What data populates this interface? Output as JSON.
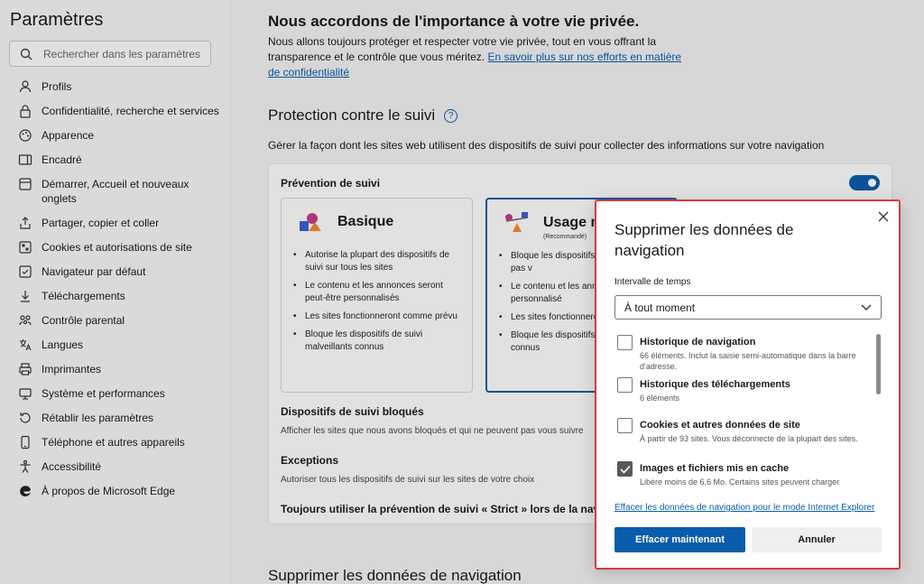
{
  "sidebar": {
    "title": "Paramètres",
    "search_placeholder": "Rechercher dans les paramètres",
    "items": [
      {
        "label": "Profils",
        "icon": "profile-icon"
      },
      {
        "label": "Confidentialité, recherche et services",
        "icon": "lock-icon"
      },
      {
        "label": "Apparence",
        "icon": "appearance-icon"
      },
      {
        "label": "Encadré",
        "icon": "sidebar-icon"
      },
      {
        "label": "Démarrer, Accueil et nouveaux onglets",
        "icon": "home-icon"
      },
      {
        "label": "Partager, copier et coller",
        "icon": "share-icon"
      },
      {
        "label": "Cookies et autorisations de site",
        "icon": "cookie-icon"
      },
      {
        "label": "Navigateur par défaut",
        "icon": "browser-icon"
      },
      {
        "label": "Téléchargements",
        "icon": "download-icon"
      },
      {
        "label": "Contrôle parental",
        "icon": "family-icon"
      },
      {
        "label": "Langues",
        "icon": "language-icon"
      },
      {
        "label": "Imprimantes",
        "icon": "printer-icon"
      },
      {
        "label": "Système et performances",
        "icon": "system-icon"
      },
      {
        "label": "Rétablir les paramètres",
        "icon": "reset-icon"
      },
      {
        "label": "Téléphone et autres appareils",
        "icon": "phone-icon"
      },
      {
        "label": "Accessibilité",
        "icon": "accessibility-icon"
      },
      {
        "label": "À propos de Microsoft Edge",
        "icon": "edge-icon"
      }
    ]
  },
  "main": {
    "privacy_title": "Nous accordons de l'importance à votre vie privée.",
    "privacy_desc": "Nous allons toujours protéger et respecter votre vie privée, tout en vous offrant la transparence et le contrôle que vous méritez.",
    "privacy_link": "En savoir plus sur nos efforts en matière de confidentialité",
    "tracking_title": "Protection contre le suivi",
    "tracking_desc": "Gérer la façon dont les sites web utilisent des dispositifs de suivi pour collecter des informations sur votre navigation",
    "prevention_label": "Prévention de suivi",
    "prevention_enabled": true,
    "options": {
      "basic": {
        "name": "Basique",
        "bullets": [
          "Autorise la plupart des dispositifs de suivi sur tous les sites",
          "Le contenu et les annonces seront peut-être personnalisés",
          "Les sites fonctionneront comme prévu",
          "Bloque les dispositifs de suivi malveillants connus"
        ]
      },
      "balanced": {
        "name": "Usage n",
        "sub": "(Recommandé)",
        "bullets": [
          "Bloque les dispositifs que vous n'avez pas v",
          "Le contenu et les annc être moins personnalisé",
          "Les sites fonctionneront",
          "Bloque les dispositifs malveillants connus"
        ]
      }
    },
    "blocked_title": "Dispositifs de suivi bloqués",
    "blocked_desc": "Afficher les sites que nous avons bloqués et qui ne peuvent pas vous suivre",
    "exceptions_title": "Exceptions",
    "exceptions_desc": "Autoriser tous les dispositifs de suivi sur les sites de votre choix",
    "strict_text": "Toujours utiliser la prévention de suivi « Strict » lors de la navigat",
    "clear_section_title": "Supprimer les données de navigation"
  },
  "dialog": {
    "title": "Supprimer les données de navigation",
    "range_label": "Intervalle de temps",
    "range_value": "À tout moment",
    "items": [
      {
        "title": "Historique de navigation",
        "desc": "66 éléments. Inclut la saisie semi-automatique dans la barre d'adresse.",
        "checked": false
      },
      {
        "title": "Historique des téléchargements",
        "desc": "6 éléments",
        "checked": false
      },
      {
        "title": "Cookies et autres données de site",
        "desc": "À partir de 93 sites. Vous déconnecte de la plupart des sites.",
        "checked": false
      },
      {
        "title": "Images et fichiers mis en cache",
        "desc": "Libère moins de 6,6 Mo. Certains sites peuvent charger",
        "checked": true
      }
    ],
    "ie_link": "Effacer les données de navigation pour le mode Internet Explorer",
    "primary_button": "Effacer maintenant",
    "secondary_button": "Annuler"
  },
  "colors": {
    "accent": "#0a5cad",
    "dialog_border": "#d43c3c"
  }
}
